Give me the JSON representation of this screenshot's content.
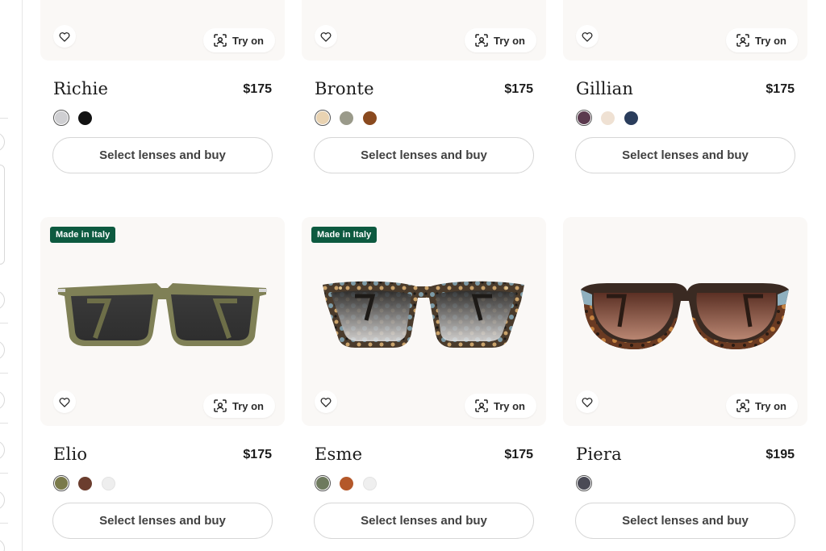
{
  "products": [
    {
      "name": "Richie",
      "price": "$175",
      "badge": "",
      "try_on_label": "Try on",
      "buy_label": "Select lenses and buy",
      "swatches": [
        {
          "color": "#cfcfd2",
          "selected": true
        },
        {
          "color": "#121212",
          "selected": false
        }
      ]
    },
    {
      "name": "Bronte",
      "price": "$175",
      "badge": "",
      "try_on_label": "Try on",
      "buy_label": "Select lenses and buy",
      "swatches": [
        {
          "color": "#e9d3b2",
          "selected": true
        },
        {
          "color": "#9a9a8a",
          "selected": false
        },
        {
          "color": "#8a4a1f",
          "selected": false
        }
      ]
    },
    {
      "name": "Gillian",
      "price": "$175",
      "badge": "",
      "try_on_label": "Try on",
      "buy_label": "Select lenses and buy",
      "swatches": [
        {
          "color": "#5b3a4e",
          "selected": true
        },
        {
          "color": "#efe1d3",
          "selected": false
        },
        {
          "color": "#2a3d5c",
          "selected": false
        }
      ]
    },
    {
      "name": "Elio",
      "price": "$175",
      "badge": "Made in Italy",
      "try_on_label": "Try on",
      "buy_label": "Select lenses and buy",
      "frame_color": "#7f8056",
      "lens_color": "#3b3b3b",
      "accent_color": "#6d6e48",
      "swatches": [
        {
          "color": "#7a7a4a",
          "selected": true
        },
        {
          "color": "#6b3d2e",
          "selected": false
        },
        {
          "color": "#eeeeee",
          "selected": false
        }
      ]
    },
    {
      "name": "Esme",
      "price": "$175",
      "badge": "Made in Italy",
      "try_on_label": "Try on",
      "buy_label": "Select lenses and buy",
      "frame_color": "#4a3b2c",
      "lens_color": "#6f6f6f",
      "accent_color": "#7c9aa6",
      "swatches": [
        {
          "color": "#6e7a5e",
          "selected": true
        },
        {
          "color": "#b4582a",
          "selected": false
        },
        {
          "color": "#efefef",
          "selected": false
        }
      ]
    },
    {
      "name": "Piera",
      "price": "$195",
      "badge": "",
      "try_on_label": "Try on",
      "buy_label": "Select lenses and buy",
      "frame_color": "#3a2a22",
      "lens_color": "#7a4b3c",
      "accent_color": "#8fb0bf",
      "swatches": [
        {
          "color": "#4a4a55",
          "selected": true
        }
      ]
    }
  ],
  "icons": {
    "favorite": "heart-outline-icon",
    "try_on": "face-scan-icon"
  }
}
